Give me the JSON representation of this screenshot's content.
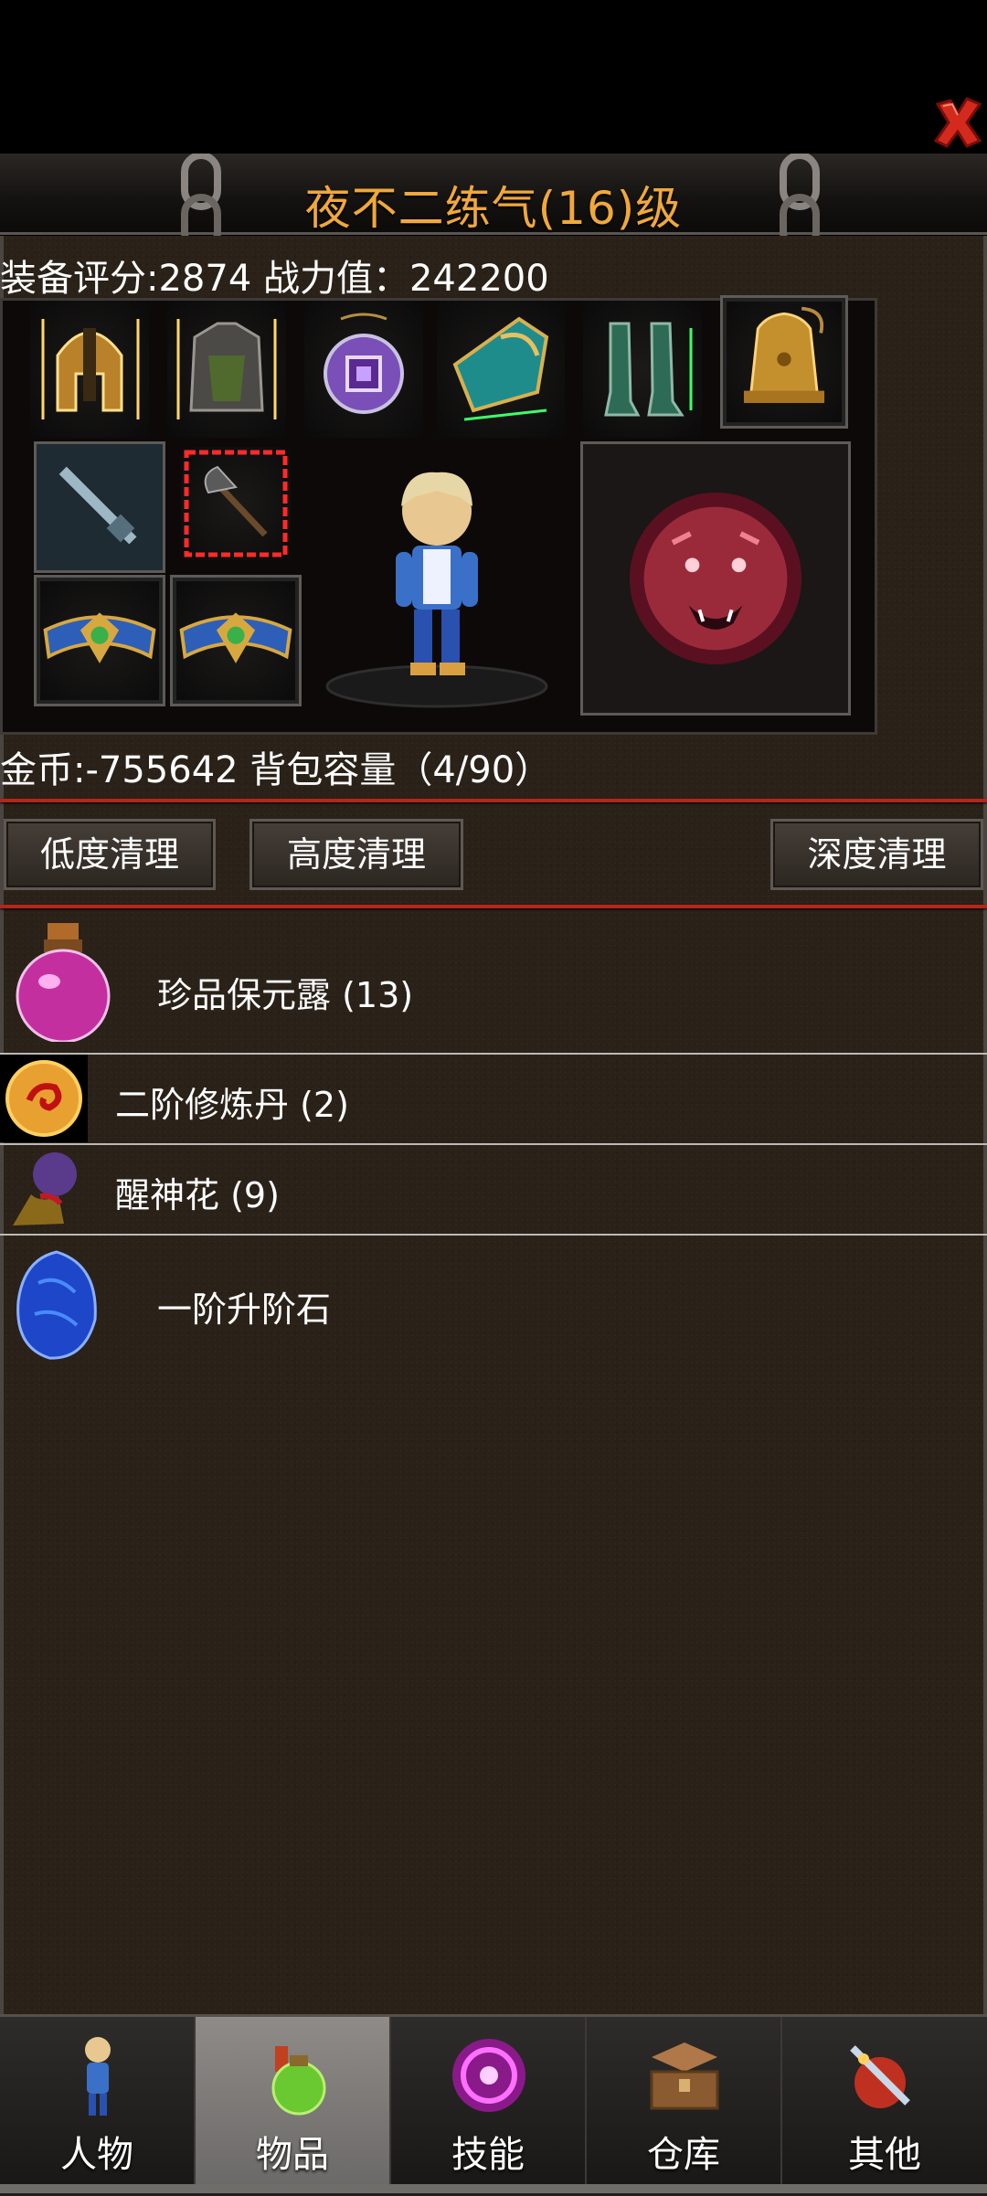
{
  "header": {
    "title": "夜不二练气(16)级",
    "close_icon": "close-x-icon"
  },
  "stats": {
    "text": "装备评分:2874 战力值：242200"
  },
  "inventory_summary": {
    "text": "金币:-755642 背包容量（4/90）"
  },
  "clean_buttons": {
    "low": "低度清理",
    "high": "高度清理",
    "deep": "深度清理"
  },
  "equipment_slots": [
    {
      "icon": "helmet-icon"
    },
    {
      "icon": "armor-icon"
    },
    {
      "icon": "amulet-icon"
    },
    {
      "icon": "bracer-icon"
    },
    {
      "icon": "boots-icon"
    },
    {
      "icon": "bell-icon"
    },
    {
      "icon": "sword-icon"
    },
    {
      "icon": "axe-icon"
    },
    {
      "icon": "belt-icon"
    },
    {
      "icon": "belt-icon"
    },
    {
      "icon": "tiger-mount-icon"
    }
  ],
  "items": [
    {
      "name": "珍品保元露 (13)",
      "icon": "potion-icon"
    },
    {
      "name": "二阶修炼丹 (2)",
      "icon": "pill-icon"
    },
    {
      "name": "醒神花 (9)",
      "icon": "flower-icon"
    },
    {
      "name": "一阶升阶石",
      "icon": "blue-stone-icon"
    }
  ],
  "nav": {
    "tabs": [
      {
        "label": "人物",
        "icon": "character-icon",
        "active": false
      },
      {
        "label": "物品",
        "icon": "items-bag-icon",
        "active": true
      },
      {
        "label": "技能",
        "icon": "skill-orb-icon",
        "active": false
      },
      {
        "label": "仓库",
        "icon": "chest-icon",
        "active": false
      },
      {
        "label": "其他",
        "icon": "other-icon",
        "active": false
      }
    ]
  },
  "colors": {
    "title": "#f0a83c",
    "accent_line": "#b3261e",
    "panel": "#2a2119"
  }
}
